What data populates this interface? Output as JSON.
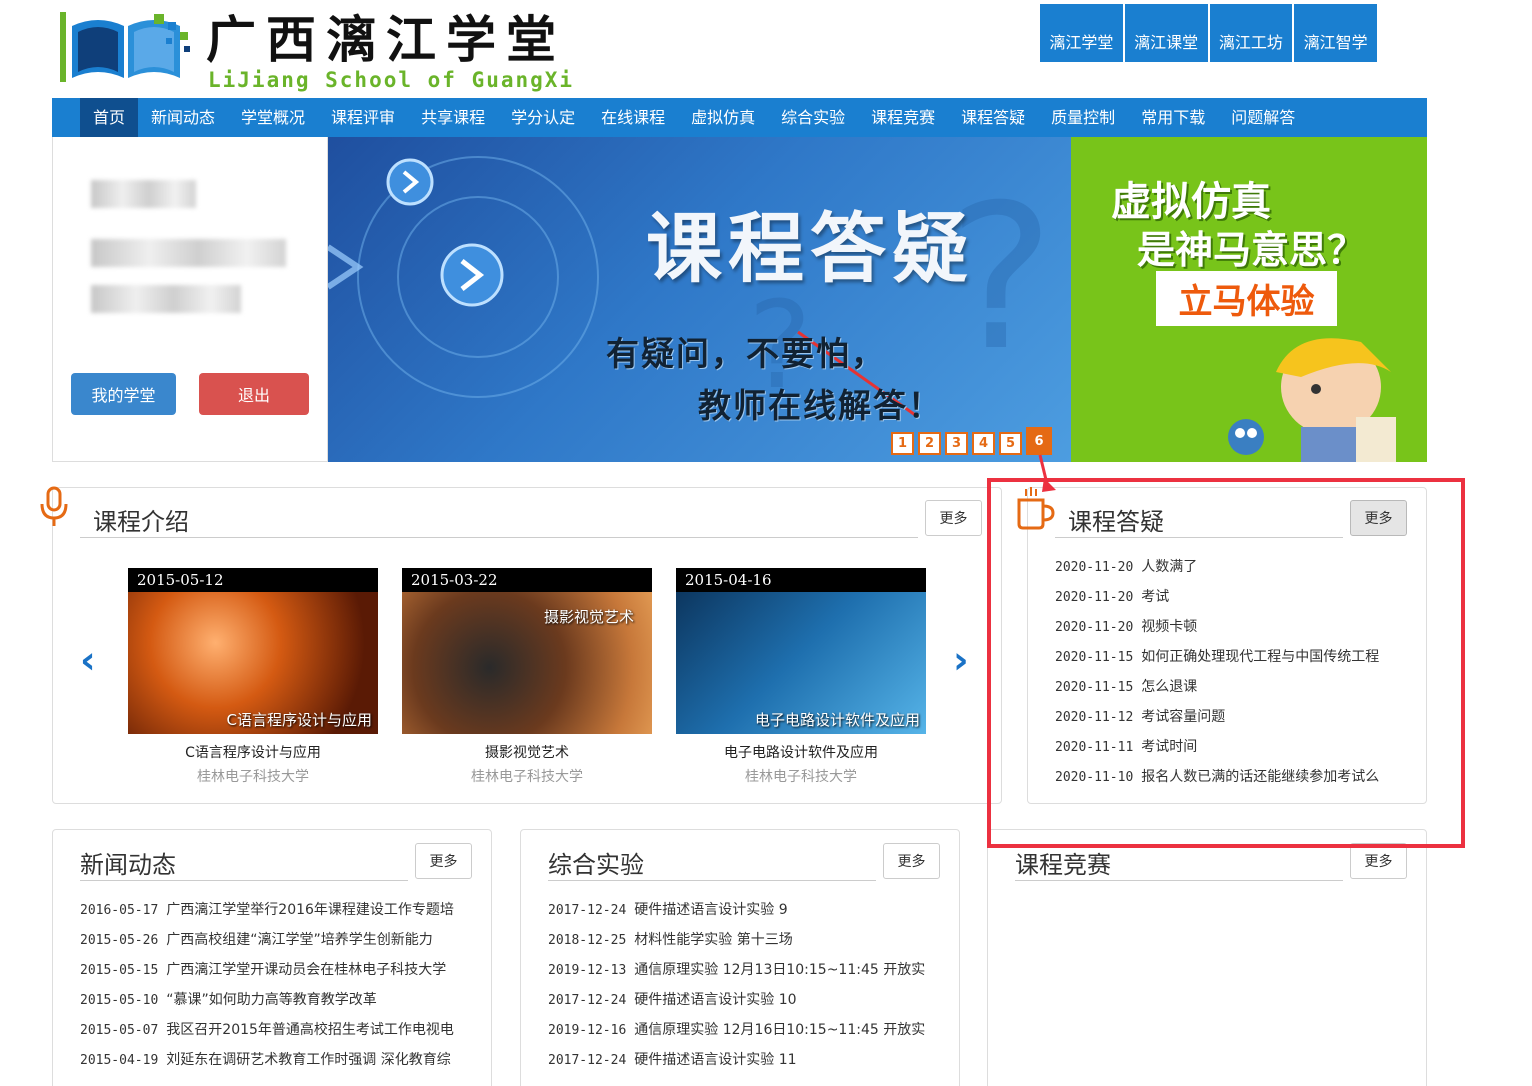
{
  "header": {
    "logo_title": "广西漓江学堂",
    "logo_subtitle": "LiJiang School of GuangXi",
    "top_links": [
      "漓江学堂",
      "漓江课堂",
      "漓江工坊",
      "漓江智学"
    ]
  },
  "nav": {
    "items": [
      "首页",
      "新闻动态",
      "学堂概况",
      "课程评审",
      "共享课程",
      "学分认定",
      "在线课程",
      "虚拟仿真",
      "综合实验",
      "课程竞赛",
      "课程答疑",
      "质量控制",
      "常用下载",
      "问题解答"
    ],
    "active": "首页"
  },
  "login": {
    "my_button": "我的学堂",
    "logout_button": "退出"
  },
  "banner": {
    "title": "课程答疑",
    "line1": "有疑问，不要怕，",
    "line2": "教师在线解答！",
    "dots": [
      "1",
      "2",
      "3",
      "4",
      "5",
      "6"
    ],
    "active_dot": "6"
  },
  "ad": {
    "line1": "虚拟仿真",
    "line2": "是神马意思？",
    "button": "立马体验"
  },
  "intro": {
    "title": "课程介绍",
    "more": "更多",
    "courses": [
      {
        "date": "2015-05-12",
        "overlay": "C语言程序设计与应用",
        "name": "C语言程序设计与应用",
        "school": "桂林电子科技大学"
      },
      {
        "date": "2015-03-22",
        "overlay": "摄影视觉艺术",
        "name": "摄影视觉艺术",
        "school": "桂林电子科技大学"
      },
      {
        "date": "2015-04-16",
        "overlay": "电子电路设计软件及应用",
        "name": "电子电路设计软件及应用",
        "school": "桂林电子科技大学"
      }
    ]
  },
  "qa": {
    "title": "课程答疑",
    "more": "更多",
    "items": [
      {
        "date": "2020-11-20",
        "text": "人数满了"
      },
      {
        "date": "2020-11-20",
        "text": "考试"
      },
      {
        "date": "2020-11-20",
        "text": "视频卡顿"
      },
      {
        "date": "2020-11-15",
        "text": "如何正确处理现代工程与中国传统工程"
      },
      {
        "date": "2020-11-15",
        "text": "怎么退课"
      },
      {
        "date": "2020-11-12",
        "text": "考试容量问题"
      },
      {
        "date": "2020-11-11",
        "text": "考试时间"
      },
      {
        "date": "2020-11-10",
        "text": "报名人数已满的话还能继续参加考试么"
      }
    ]
  },
  "news": {
    "title": "新闻动态",
    "more": "更多",
    "items": [
      {
        "date": "2016-05-17",
        "text": "广西漓江学堂举行2016年课程建设工作专题培"
      },
      {
        "date": "2015-05-26",
        "text": "广西高校组建“漓江学堂”培养学生创新能力"
      },
      {
        "date": "2015-05-15",
        "text": "广西漓江学堂开课动员会在桂林电子科技大学"
      },
      {
        "date": "2015-05-10",
        "text": "“慕课”如何助力高等教育教学改革"
      },
      {
        "date": "2015-05-07",
        "text": "我区召开2015年普通高校招生考试工作电视电"
      },
      {
        "date": "2015-04-19",
        "text": "刘延东在调研艺术教育工作时强调 深化教育综"
      }
    ]
  },
  "lab": {
    "title": "综合实验",
    "more": "更多",
    "items": [
      {
        "date": "2017-12-24",
        "text": "硬件描述语言设计实验 9"
      },
      {
        "date": "2018-12-25",
        "text": "材料性能学实验 第十三场"
      },
      {
        "date": "2019-12-13",
        "text": "通信原理实验 12月13日10:15~11:45 开放实"
      },
      {
        "date": "2017-12-24",
        "text": "硬件描述语言设计实验 10"
      },
      {
        "date": "2019-12-16",
        "text": "通信原理实验 12月16日10:15~11:45 开放实"
      },
      {
        "date": "2017-12-24",
        "text": "硬件描述语言设计实验 11"
      }
    ]
  },
  "contest": {
    "title": "课程竞赛",
    "more": "更多"
  },
  "colors": {
    "brand_blue": "#1a7fd0",
    "nav_active": "#0f4f8f",
    "highlight_red": "#ec3140",
    "accent_orange": "#e56a14"
  }
}
